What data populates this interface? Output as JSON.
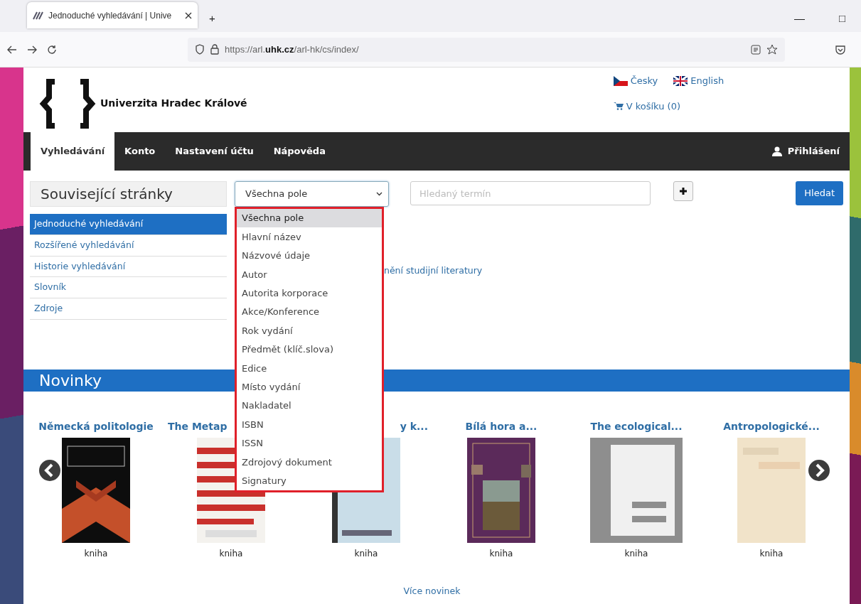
{
  "browser": {
    "tab_title": "Jednoduché vyhledávání | Unive",
    "new_tab": "+",
    "url": "https://arl.**uhk.cz**/arl-hk/cs/index/",
    "window_controls": [
      "—",
      "□"
    ]
  },
  "header": {
    "logo_text": "Univerzita Hradec Králové",
    "languages": [
      {
        "label": "Česky",
        "kind": "cz"
      },
      {
        "label": "English",
        "kind": "gb"
      }
    ],
    "cart": "V košíku (0)"
  },
  "nav": {
    "items": [
      {
        "label": "Vyhledávání",
        "selected": true
      },
      {
        "label": "Konto",
        "selected": false
      },
      {
        "label": "Nastavení účtu",
        "selected": false
      },
      {
        "label": "Nápověda",
        "selected": false
      }
    ],
    "login": "Přihlášení"
  },
  "sidebar": {
    "title": "Související stránky",
    "items": [
      {
        "label": "Jednoduché vyhledávání",
        "selected": true
      },
      {
        "label": "Rozšířené vyhledávání",
        "selected": false
      },
      {
        "label": "Historie vyhledávání",
        "selected": false
      },
      {
        "label": "Slovník",
        "selected": false
      },
      {
        "label": "Zdroje",
        "selected": false
      }
    ]
  },
  "search": {
    "field_select": {
      "value": "Všechna pole",
      "expanded": true,
      "options": [
        {
          "label": "Všechna pole",
          "selected": true
        },
        {
          "label": "Hlavní název",
          "selected": false
        },
        {
          "label": "Názvové údaje",
          "selected": false
        },
        {
          "label": "Autor",
          "selected": false
        },
        {
          "label": "Autorita korporace",
          "selected": false
        },
        {
          "label": "Akce/Konference",
          "selected": false
        },
        {
          "label": "Rok vydání",
          "selected": false
        },
        {
          "label": "Předmět (klíč.slova)",
          "selected": false
        },
        {
          "label": "Edice",
          "selected": false
        },
        {
          "label": "Místo vydání",
          "selected": false
        },
        {
          "label": "Nakladatel",
          "selected": false
        },
        {
          "label": "ISBN",
          "selected": false
        },
        {
          "label": "ISSN",
          "selected": false
        },
        {
          "label": "Zdrojový dokument",
          "selected": false
        },
        {
          "label": "Signatury",
          "selected": false
        }
      ]
    },
    "term": {
      "placeholder": "Hledaný termín"
    },
    "submit": "Hledat"
  },
  "content_link": "nění studijní literatury",
  "news": {
    "title": "Novinky",
    "books": [
      {
        "title": "Německá politologie",
        "type": "kniha",
        "kind": "picture",
        "cut_left": false,
        "cut_right": false
      },
      {
        "title": "The Metap",
        "type": "kniha",
        "kind": "picture",
        "cut_left": false,
        "cut_right": true
      },
      {
        "title": "y k...",
        "type": "kniha",
        "kind": "picture",
        "cut_left": true,
        "cut_right": false
      },
      {
        "title": "Bílá hora a...",
        "type": "kniha",
        "kind": "picture",
        "cut_left": false,
        "cut_right": false
      },
      {
        "title": "The ecological...",
        "type": "kniha",
        "kind": "placeholder",
        "cut_left": false,
        "cut_right": false
      },
      {
        "title": "Antropologické...",
        "type": "kniha",
        "kind": "picture",
        "cut_left": false,
        "cut_right": false
      }
    ],
    "more": "Více novinek"
  }
}
